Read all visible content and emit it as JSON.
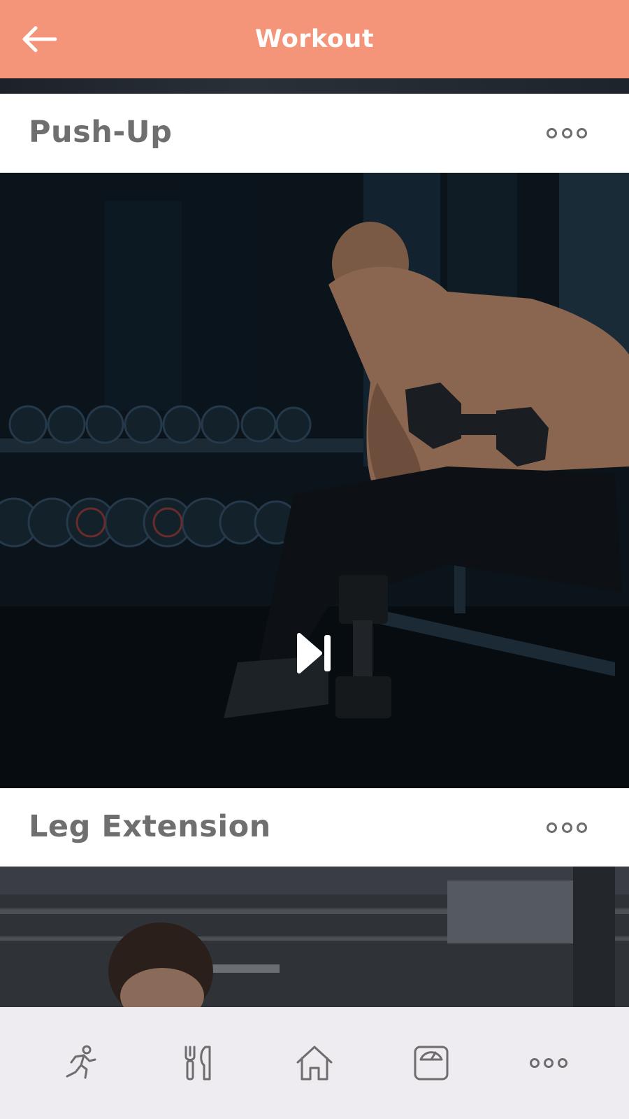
{
  "header": {
    "title": "Workout",
    "back_icon": "arrow-left-icon",
    "background_color": "#f4957a"
  },
  "workouts": [
    {
      "title": "Push-Up",
      "menu_icon": "more-horizontal-icon",
      "media_control_icon": "play-pause-icon"
    },
    {
      "title": "Leg Extension",
      "menu_icon": "more-horizontal-icon"
    }
  ],
  "bottom_nav": {
    "items": [
      {
        "icon": "running-icon"
      },
      {
        "icon": "fork-knife-icon"
      },
      {
        "icon": "home-icon"
      },
      {
        "icon": "scale-icon"
      },
      {
        "icon": "more-horizontal-icon"
      }
    ],
    "background_color": "#efecf1"
  }
}
